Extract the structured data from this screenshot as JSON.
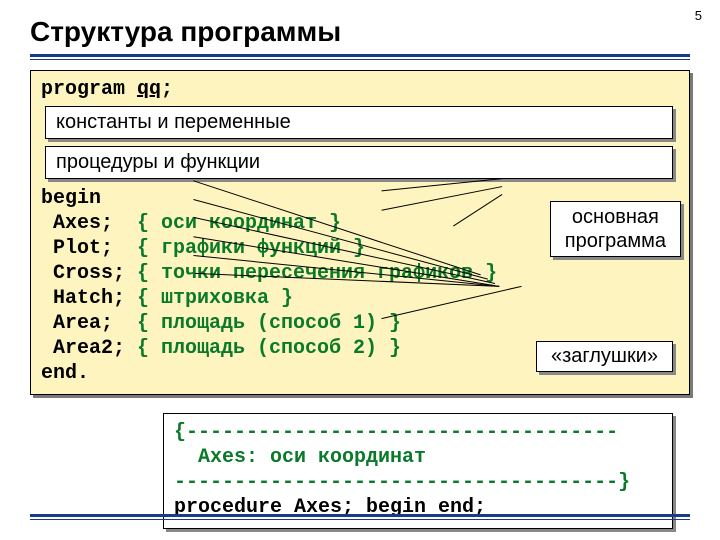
{
  "page_number": "5",
  "title": "Структура программы",
  "program_decl_pre": "program ",
  "program_decl_name": "qq",
  "program_decl_post": ";",
  "inset1": "константы и переменные",
  "inset2": "процедуры и функции",
  "begin_kw": "begin",
  "lines": [
    {
      "call": " Axes;  ",
      "cm": "{ оси координат }"
    },
    {
      "call": " Plot;  ",
      "cm": "{ графики функций }"
    },
    {
      "call": " Cross; ",
      "cm": "{ точки пересечения графиков }"
    },
    {
      "call": " Hatch; ",
      "cm": "{ штриховка }"
    },
    {
      "call": " Area;  ",
      "cm": "{ площадь (способ 1) }"
    },
    {
      "call": " Area2; ",
      "cm": "{ площадь (способ 2) }"
    }
  ],
  "end_kw": "end.",
  "callout_main_line1": "основная",
  "callout_main_line2": "программа",
  "callout_stubs": "«заглушки»",
  "lower_green1": "{------------------------------------",
  "lower_green2": "  Axes: оси координат",
  "lower_green3": "-------------------------------------}",
  "lower_proc": "procedure Axes; begin end;"
}
